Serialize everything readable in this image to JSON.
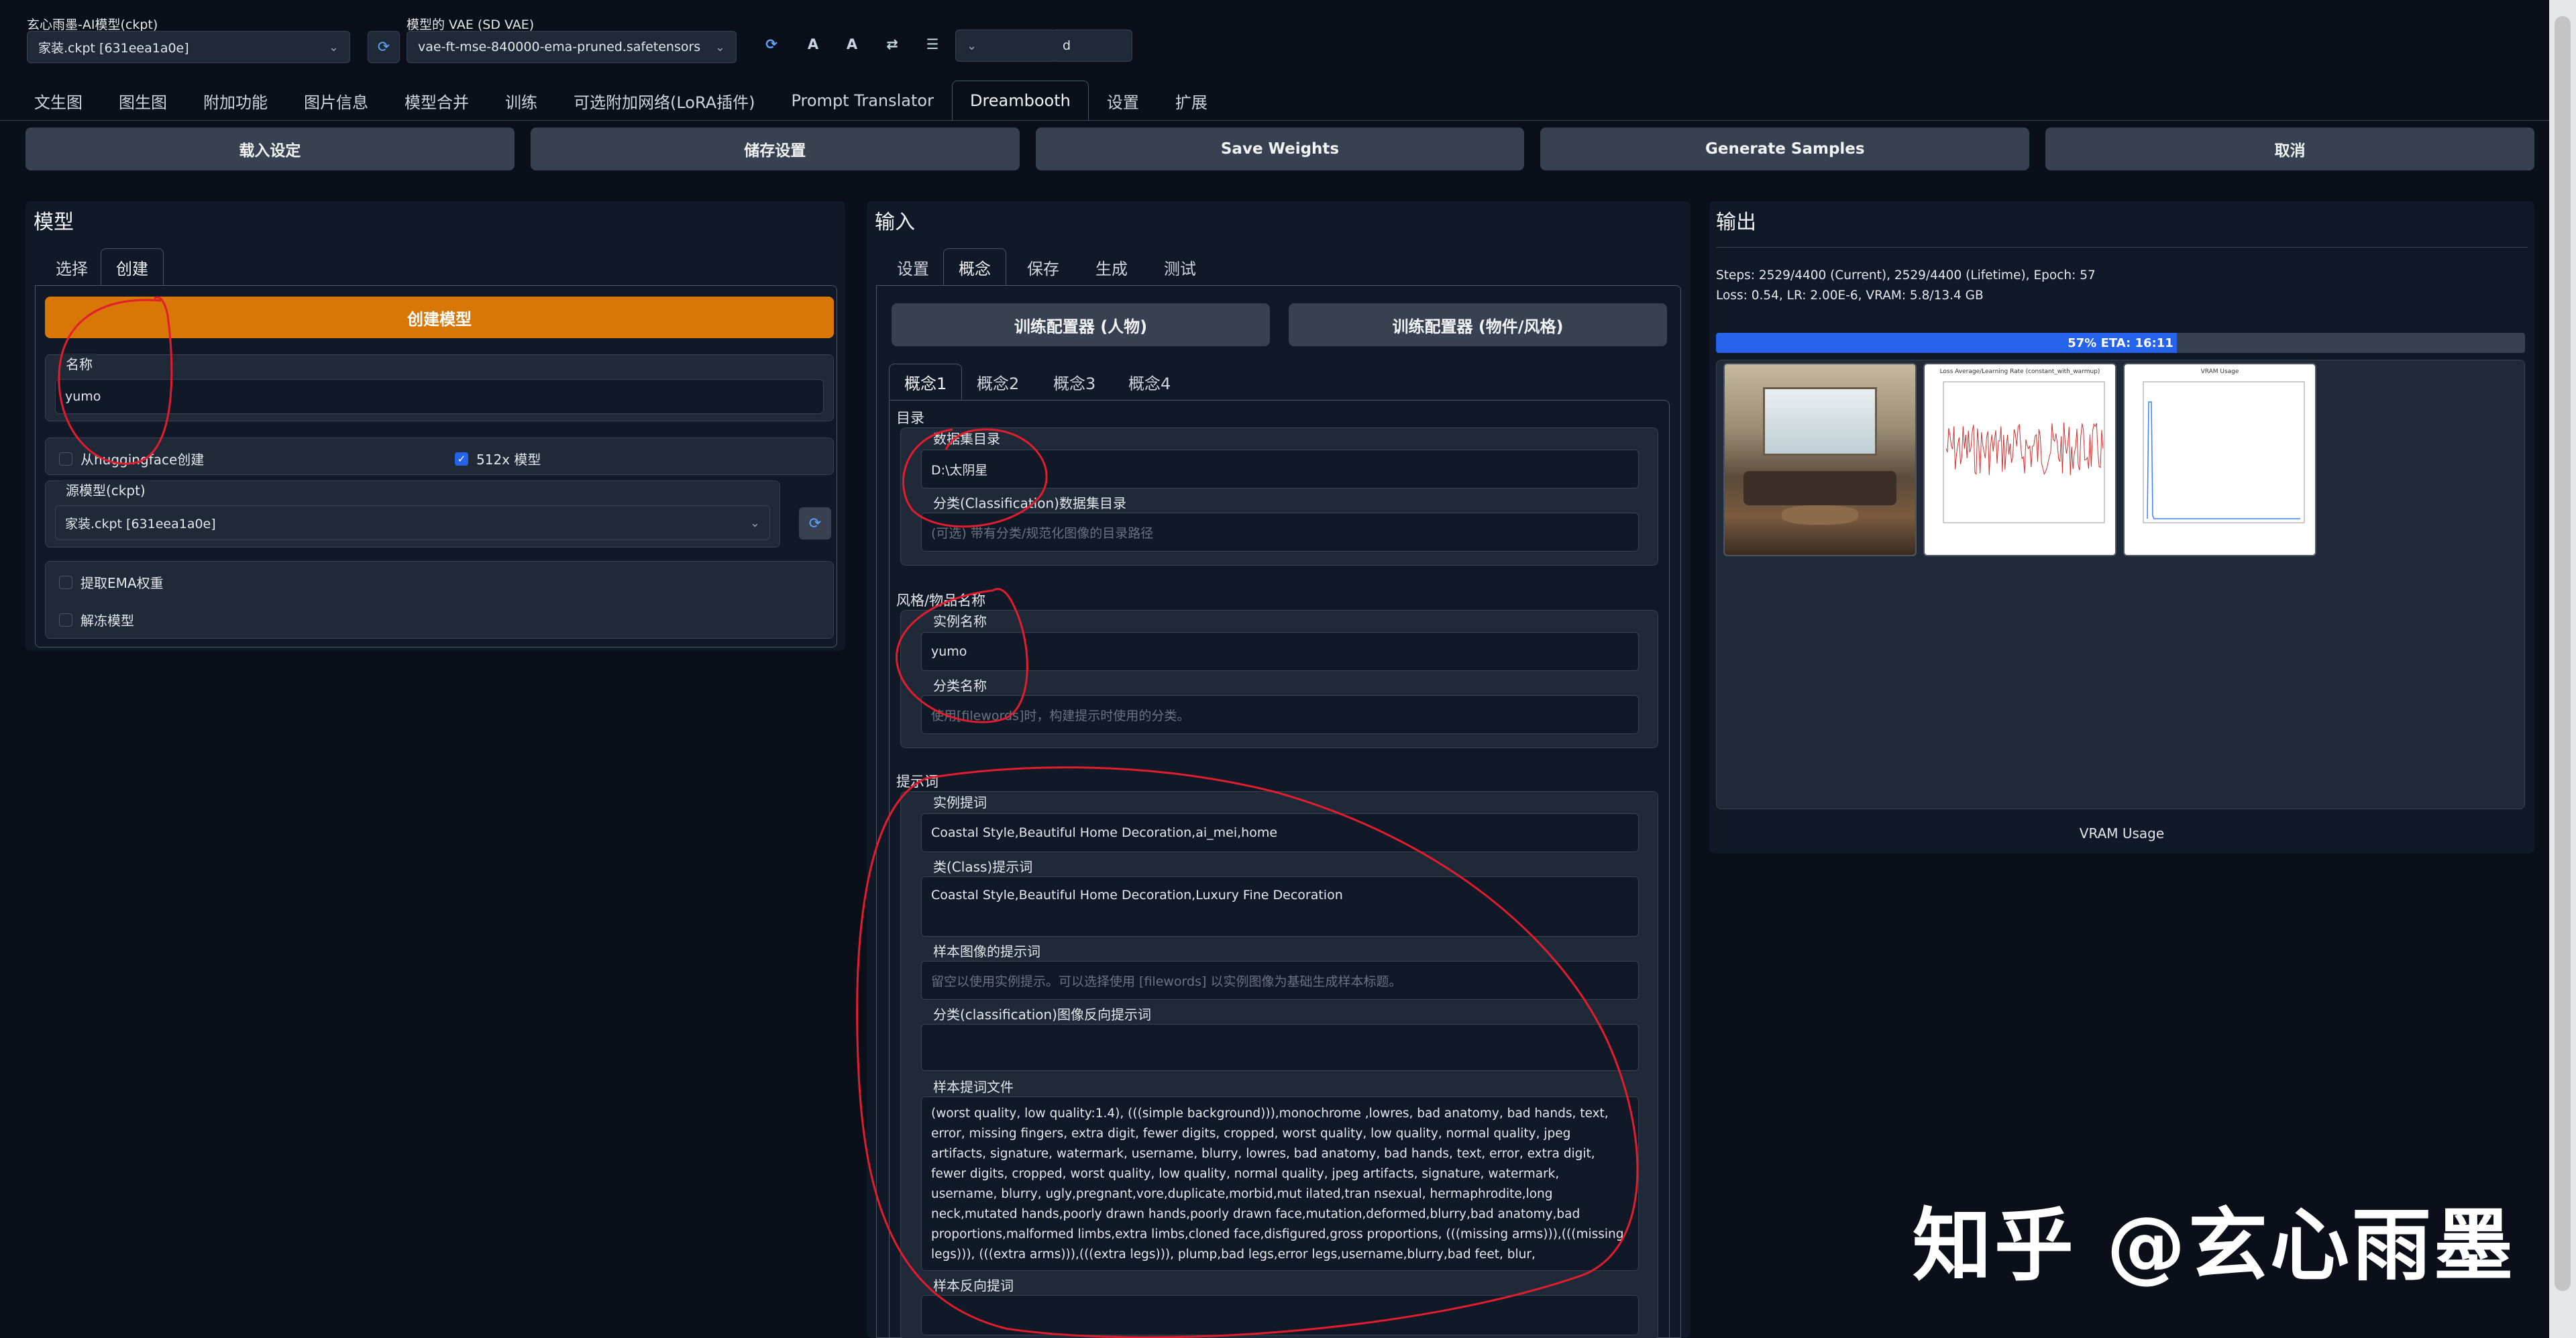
{
  "topbar": {
    "checkpoint_label": "玄心雨墨-AI模型(ckpt)",
    "checkpoint_value": "家装.ckpt [631eea1a0e]",
    "vae_label": "模型的 VAE (SD VAE)",
    "vae_value": "vae-ft-mse-840000-ema-pruned.safetensors",
    "extra_value": "d"
  },
  "tabs": [
    "文生图",
    "图生图",
    "附加功能",
    "图片信息",
    "模型合并",
    "训练",
    "可选附加网络(LoRA插件)",
    "Prompt Translator",
    "Dreambooth",
    "设置",
    "扩展"
  ],
  "actions": [
    "载入设定",
    "储存设置",
    "Save Weights",
    "Generate Samples",
    "取消"
  ],
  "model_panel": {
    "title": "模型",
    "tabs": [
      "选择",
      "创建"
    ],
    "create_button": "创建模型",
    "name_label": "名称",
    "name_value": "yumo",
    "from_hf_label": "从huggingface创建",
    "model_512_label": "512x 模型",
    "source_label": "源模型(ckpt)",
    "source_value": "家装.ckpt [631eea1a0e]",
    "extract_ema_label": "提取EMA权重",
    "unfreeze_label": "解冻模型"
  },
  "input_panel": {
    "title": "输入",
    "tabs": [
      "设置",
      "概念",
      "保存",
      "生成",
      "测试"
    ],
    "trainer_person": "训练配置器 (人物)",
    "trainer_style": "训练配置器 (物件/风格)",
    "concept_tabs": [
      "概念1",
      "概念2",
      "概念3",
      "概念4"
    ],
    "directory_title": "目录",
    "dataset_dir_label": "数据集目录",
    "dataset_dir_value": "D:\\太阴星",
    "class_dir_label": "分类(Classification)数据集目录",
    "class_dir_placeholder": "(可选) 带有分类/规范化图像的目录路径",
    "style_title": "风格/物品名称",
    "instance_name_label": "实例名称",
    "instance_name_value": "yumo",
    "class_name_label": "分类名称",
    "class_name_placeholder": "使用[filewords]时，构建提示时使用的分类。",
    "prompt_title": "提示词",
    "instance_prompt_label": "实例提词",
    "instance_prompt_value": "Coastal Style,Beautiful Home Decoration,ai_mei,home",
    "class_prompt_label": "类(Class)提示词",
    "class_prompt_value": "Coastal Style,Beautiful Home Decoration,Luxury Fine Decoration",
    "sample_prompt_label": "样本图像的提示词",
    "sample_prompt_placeholder": "留空以使用实例提示。可以选择使用 [filewords] 以实例图像为基础生成样本标题。",
    "class_negative_label": "分类(classification)图像反向提示词",
    "sample_template_label": "样本提词文件",
    "sample_template_value": "(worst quality, low quality:1.4), (((simple background))),monochrome ,lowres, bad anatomy, bad hands, text, error, missing fingers, extra digit, fewer digits, cropped, worst quality, low quality, normal quality, jpeg artifacts, signature, watermark, username, blurry, lowres, bad anatomy, bad hands, text, error, extra digit, fewer digits, cropped, worst quality, low quality, normal quality, jpeg artifacts, signature, watermark, username, blurry, ugly,pregnant,vore,duplicate,morbid,mut ilated,tran nsexual, hermaphrodite,long neck,mutated hands,poorly drawn hands,poorly drawn face,mutation,deformed,blurry,bad anatomy,bad proportions,malformed limbs,extra limbs,cloned face,disfigured,gross proportions, (((missing arms))),(((missing legs))), (((extra arms))),(((extra legs))), plump,bad legs,error legs,username,blurry,bad feet, blur,",
    "sample_negative_label": "样本反向提词"
  },
  "output_panel": {
    "title": "输出",
    "stats_line1": "Steps: 2529/4400 (Current), 2529/4400 (Lifetime), Epoch: 57",
    "stats_line2": "Loss: 0.54, LR: 2.00E-6, VRAM: 5.8/13.4 GB",
    "progress_text": "57% ETA: 16:11",
    "progress_fraction": 0.57,
    "chart1_title": "Loss Average/Learning Rate (constant_with_warmup)",
    "chart2_title": "VRAM Usage",
    "vram_label": "VRAM Usage"
  },
  "watermark": "知乎 @玄心雨墨",
  "colors": {
    "background": "#0b0f19",
    "panel": "#111827",
    "orange": "#d97706",
    "accent_blue": "#2563eb",
    "annotation_red": "#e11d2e"
  }
}
